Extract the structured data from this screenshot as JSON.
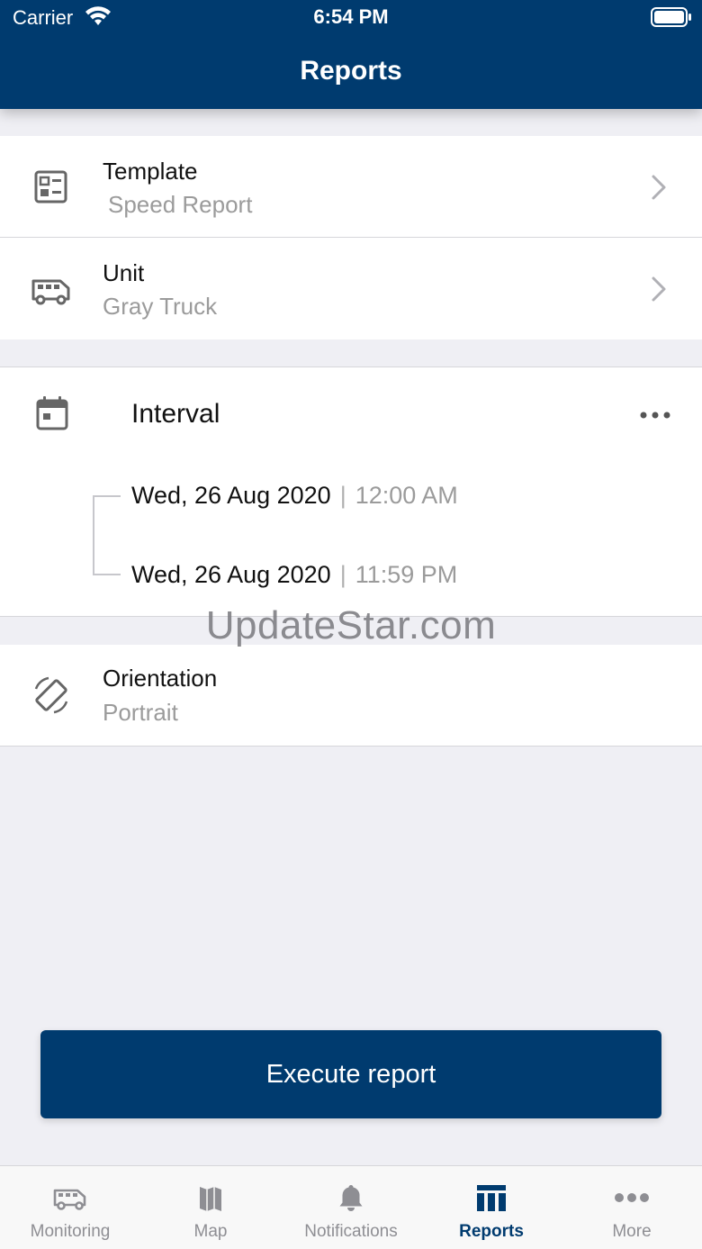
{
  "status_bar": {
    "carrier": "Carrier",
    "time": "6:54 PM"
  },
  "header": {
    "title": "Reports"
  },
  "template": {
    "label": "Template",
    "value": "Speed Report",
    "icon": "template-icon"
  },
  "unit": {
    "label": "Unit",
    "value": "Gray Truck",
    "icon": "truck-icon"
  },
  "interval": {
    "label": "Interval",
    "icon": "calendar-icon",
    "start": {
      "date": "Wed, 26 Aug 2020",
      "time": "12:00 AM"
    },
    "end": {
      "date": "Wed, 26 Aug 2020",
      "time": "11:59 PM"
    }
  },
  "watermark": "UpdateStar.com",
  "orientation": {
    "label": "Orientation",
    "value": "Portrait",
    "icon": "rotate-icon"
  },
  "execute_button": {
    "label": "Execute report"
  },
  "tabbar": {
    "tabs": [
      {
        "label": "Monitoring",
        "icon": "truck-icon",
        "active": false
      },
      {
        "label": "Map",
        "icon": "map-icon",
        "active": false
      },
      {
        "label": "Notifications",
        "icon": "bell-icon",
        "active": false
      },
      {
        "label": "Reports",
        "icon": "reports-icon",
        "active": true
      },
      {
        "label": "More",
        "icon": "more-dots-icon",
        "active": false
      }
    ]
  },
  "colors": {
    "primary": "#003b6f",
    "background": "#efeff4",
    "secondary_text": "#9b9b9b"
  }
}
